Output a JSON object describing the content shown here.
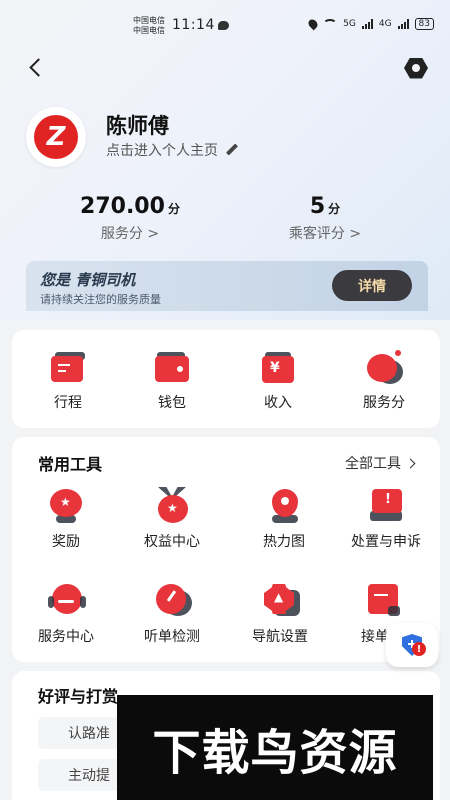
{
  "status_bar": {
    "carrier_1": "中国电信",
    "carrier_2": "中国电信",
    "time": "11:14",
    "net_1": "5G",
    "net_2": "4G",
    "battery": "83"
  },
  "profile": {
    "avatar_letter": "Z",
    "name": "陈师傅",
    "link_text": "点击进入个人主页"
  },
  "scores": [
    {
      "value": "270.00",
      "unit": "分",
      "label": "服务分 >"
    },
    {
      "value": "5",
      "unit": "分",
      "label": "乘客评分 >"
    }
  ],
  "level": {
    "title": "您是 青铜司机",
    "subtitle": "请持续关注您的服务质量",
    "detail_label": "详情"
  },
  "quick_actions": [
    {
      "label": "行程",
      "icon": "trip-icon"
    },
    {
      "label": "钱包",
      "icon": "wallet-icon"
    },
    {
      "label": "收入",
      "icon": "income-icon"
    },
    {
      "label": "服务分",
      "icon": "service-score-icon"
    }
  ],
  "tools": {
    "title": "常用工具",
    "all_label": "全部工具",
    "items": [
      {
        "label": "奖励",
        "icon": "reward-icon"
      },
      {
        "label": "权益中心",
        "icon": "benefits-icon"
      },
      {
        "label": "热力图",
        "icon": "heatmap-icon"
      },
      {
        "label": "处置与申诉",
        "icon": "appeal-icon"
      },
      {
        "label": "服务中心",
        "icon": "service-center-icon"
      },
      {
        "label": "听单检测",
        "icon": "order-check-icon"
      },
      {
        "label": "导航设置",
        "icon": "navigation-settings-icon"
      },
      {
        "label": "接单手",
        "icon": "order-taking-icon"
      }
    ]
  },
  "reviews": {
    "title": "好评与打赏",
    "tags": [
      "认路准",
      "主动提"
    ]
  },
  "floating_badge": {
    "alert": "!"
  },
  "watermark": "下载鸟资源",
  "colors": {
    "accent_red": "#e8343b",
    "dark_button": "#3b3b3f",
    "gold_text": "#f2d8a6"
  }
}
